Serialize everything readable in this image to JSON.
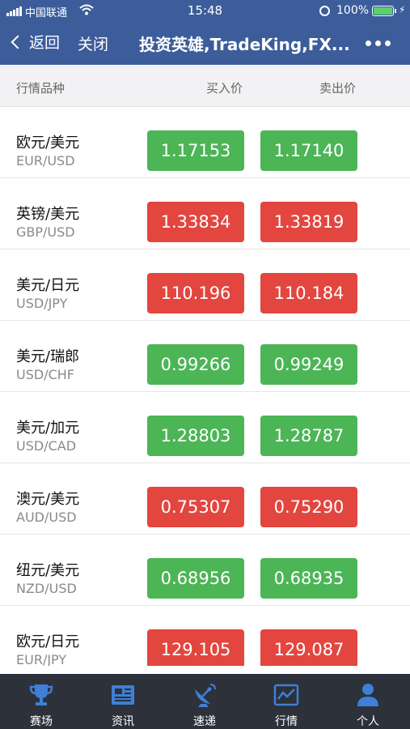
{
  "status_bar": {
    "carrier": "中国联通",
    "time": "15:48",
    "battery": "100%",
    "battery_level": 1.0
  },
  "nav": {
    "back_label": "返回",
    "close_label": "关闭",
    "title": "投资英雄,TradeKing,FX..."
  },
  "header": {
    "name": "行情品种",
    "buy": "买入价",
    "sell": "卖出价"
  },
  "colors": {
    "nav_bg": "#3c5d9a",
    "up": "#4cb556",
    "down": "#e2463f",
    "tab_bg": "#2c313a",
    "tab_icon": "#3f7fd6"
  },
  "quotes": [
    {
      "cn": "欧元/美元",
      "en": "EUR/USD",
      "buy": "1.17153",
      "sell": "1.17140",
      "trend": "up"
    },
    {
      "cn": "英镑/美元",
      "en": "GBP/USD",
      "buy": "1.33834",
      "sell": "1.33819",
      "trend": "down"
    },
    {
      "cn": "美元/日元",
      "en": "USD/JPY",
      "buy": "110.196",
      "sell": "110.184",
      "trend": "down"
    },
    {
      "cn": "美元/瑞郎",
      "en": "USD/CHF",
      "buy": "0.99266",
      "sell": "0.99249",
      "trend": "up"
    },
    {
      "cn": "美元/加元",
      "en": "USD/CAD",
      "buy": "1.28803",
      "sell": "1.28787",
      "trend": "up"
    },
    {
      "cn": "澳元/美元",
      "en": "AUD/USD",
      "buy": "0.75307",
      "sell": "0.75290",
      "trend": "down"
    },
    {
      "cn": "纽元/美元",
      "en": "NZD/USD",
      "buy": "0.68956",
      "sell": "0.68935",
      "trend": "up"
    },
    {
      "cn": "欧元/日元",
      "en": "EUR/JPY",
      "buy": "129.105",
      "sell": "129.087",
      "trend": "down"
    }
  ],
  "tabs": [
    {
      "label": "赛场",
      "icon": "trophy-icon"
    },
    {
      "label": "资讯",
      "icon": "newspaper-icon"
    },
    {
      "label": "速递",
      "icon": "satellite-dish-icon"
    },
    {
      "label": "行情",
      "icon": "line-chart-icon"
    },
    {
      "label": "个人",
      "icon": "person-icon"
    }
  ]
}
